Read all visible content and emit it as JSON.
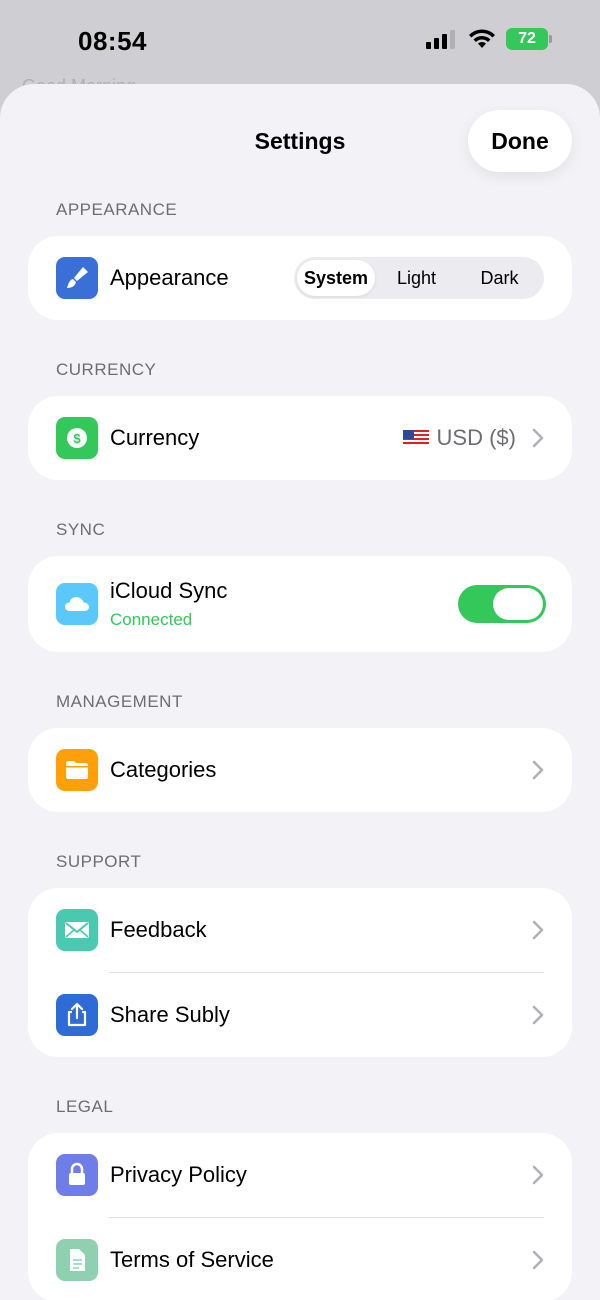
{
  "status_bar": {
    "time": "08:54",
    "battery": "72"
  },
  "behind": {
    "text": "Good Morning"
  },
  "nav": {
    "title": "Settings",
    "done_label": "Done"
  },
  "sections": {
    "appearance": {
      "header": "APPEARANCE",
      "row_label": "Appearance",
      "options": [
        "System",
        "Light",
        "Dark"
      ],
      "selected": "System",
      "icon": "paintbrush-icon",
      "icon_color": "#3a6fd8"
    },
    "currency": {
      "header": "CURRENCY",
      "row_label": "Currency",
      "value": "USD ($)",
      "icon": "dollar-icon",
      "icon_color": "#34c759"
    },
    "sync": {
      "header": "SYNC",
      "row_label": "iCloud Sync",
      "status": "Connected",
      "enabled": true,
      "icon": "cloud-icon",
      "icon_color": "#5ac8fa"
    },
    "management": {
      "header": "MANAGEMENT",
      "row_label": "Categories",
      "icon": "folder-icon",
      "icon_color": "#ff9f0a"
    },
    "support": {
      "header": "SUPPORT",
      "items": [
        {
          "label": "Feedback",
          "icon": "envelope-icon",
          "icon_color": "#48c9b0"
        },
        {
          "label": "Share Subly",
          "icon": "share-icon",
          "icon_color": "#2f6bd6"
        }
      ]
    },
    "legal": {
      "header": "LEGAL",
      "items": [
        {
          "label": "Privacy Policy",
          "icon": "lock-icon",
          "icon_color": "#6f7de8"
        },
        {
          "label": "Terms of Service",
          "icon": "document-icon",
          "icon_color": "#8fd0b0"
        }
      ]
    }
  }
}
